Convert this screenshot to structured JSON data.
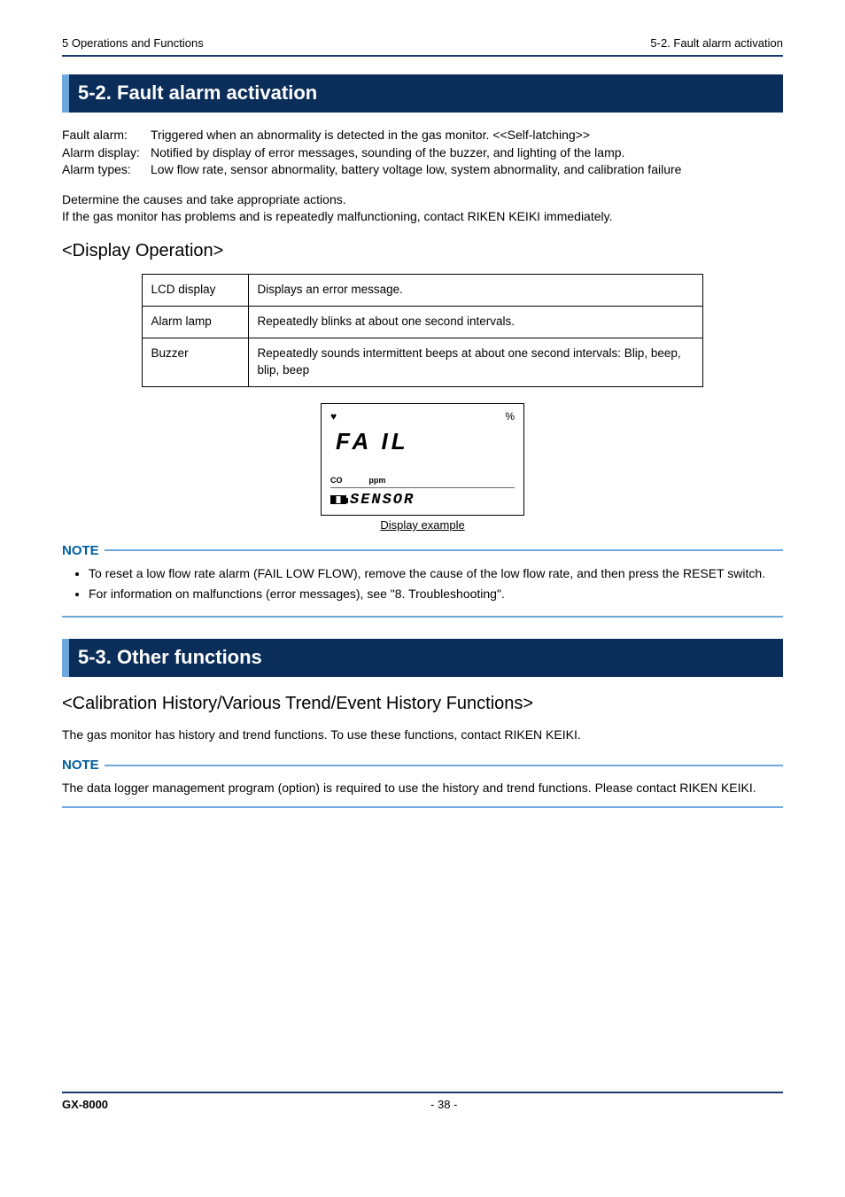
{
  "header": {
    "left": "5 Operations and Functions",
    "right": "5-2. Fault alarm activation"
  },
  "section_5_2": {
    "title": "5-2. Fault alarm activation",
    "definitions": [
      {
        "label": "Fault alarm:",
        "value": "Triggered when an abnormality is detected in the gas monitor. <<Self-latching>>"
      },
      {
        "label": "Alarm display:",
        "value": "Notified by display of error messages, sounding of the buzzer, and lighting of the lamp."
      },
      {
        "label": "Alarm types:",
        "value": "Low flow rate, sensor abnormality, battery voltage low, system abnormality, and calibration failure"
      }
    ],
    "determine_line1": "Determine the causes and take appropriate actions.",
    "determine_line2": "If the gas monitor has problems and is repeatedly malfunctioning, contact RIKEN KEIKI immediately.",
    "display_operation_heading": "<Display Operation>",
    "table": [
      {
        "c1": "LCD display",
        "c2": "Displays an error message."
      },
      {
        "c1": "Alarm lamp",
        "c2": "Repeatedly blinks at about one second intervals."
      },
      {
        "c1": "Buzzer",
        "c2": "Repeatedly sounds intermittent beeps at about one second intervals: Blip, beep, blip, beep"
      }
    ],
    "lcd": {
      "heart_icon": "heart-icon",
      "percent": "%",
      "big": "FA IL",
      "co_label": "CO",
      "ppm_label": "ppm",
      "sensor_text": "SENSOR",
      "caption": "Display example"
    },
    "note_label": "NOTE",
    "note_bullets": [
      "To reset a low flow rate alarm (FAIL LOW FLOW), remove the cause of the low flow rate, and then press the RESET switch.",
      "For information on malfunctions (error messages), see \"8. Troubleshooting\"."
    ]
  },
  "section_5_3": {
    "title": "5-3. Other functions",
    "sub_heading": "<Calibration History/Various Trend/Event History Functions>",
    "para": "The gas monitor has history and trend functions. To use these functions, contact RIKEN KEIKI.",
    "note_label": "NOTE",
    "note_text": "The data logger management program (option) is required to use the history and trend functions. Please contact RIKEN KEIKI."
  },
  "footer": {
    "model": "GX-8000",
    "page": "- 38 -"
  }
}
